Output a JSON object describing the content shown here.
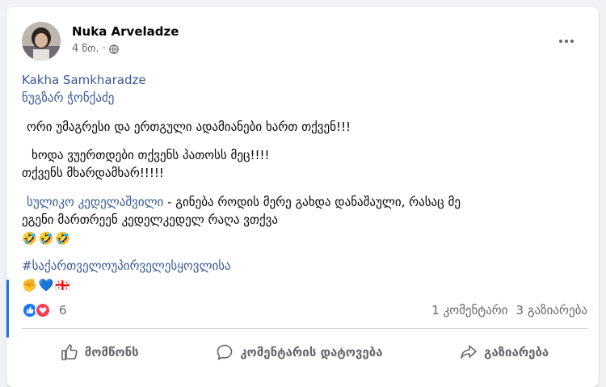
{
  "post": {
    "author": "Nuka Arveladze",
    "time": "4 წთ.",
    "separator": "·",
    "privacy_icon": "globe-icon",
    "tags": [
      "Kakha Samkharadze",
      "ნუგზარ ჭონქაძე"
    ],
    "line1": "ორი უმაგრესი და ერთგული ადამიანები ხართ თქვენ!!!",
    "line2": "ხოდა ვუერთდები თქვენს პათოსს მეც!!!!",
    "line3": "თქვენს მხარდამხარ!!!!!",
    "mention": "სულიკო კედელაშვილი",
    "line4_rest": " -  გინება როდის მერე გახდა დანაშაული, რასაც მე",
    "line5": "ეგენი მართრეენ კედელკედელ რაღა ვთქვა",
    "emoji_row1": "🤣🤣🤣",
    "hashtag": "#საქართველოუპირველესყოვლისა",
    "emoji_row2": "✊💙🇬🇪"
  },
  "stats": {
    "reaction_count": "6",
    "comments": "1 კომენტარი",
    "shares": "3 გაზიარება"
  },
  "actions": {
    "like": "მომწონს",
    "comment": "კომენტარის დატოვება",
    "share": "გაზიარება"
  },
  "colors": {
    "link": "#385898",
    "like_blue": "#1877f2",
    "love_red": "#f33e58",
    "secondary_text": "#65676b"
  }
}
